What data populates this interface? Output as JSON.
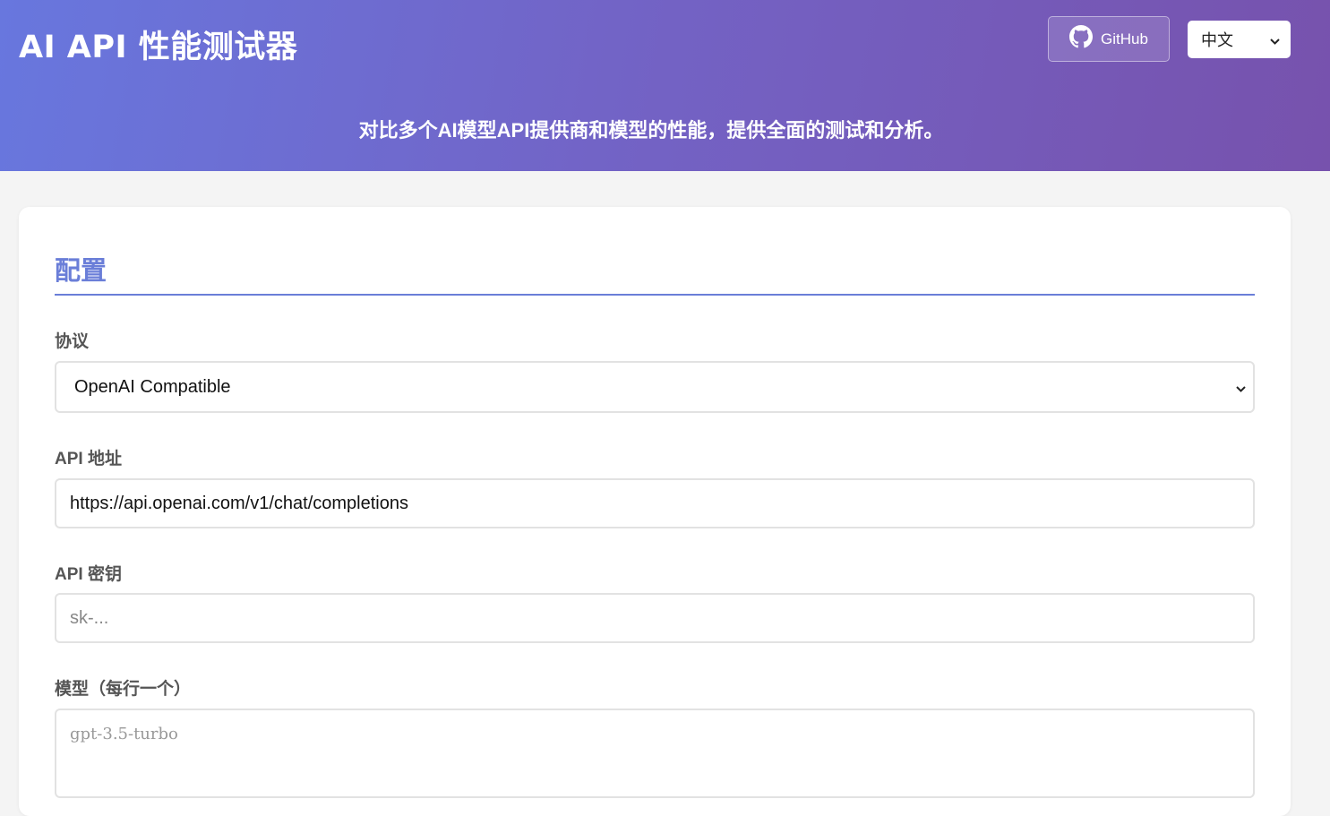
{
  "header": {
    "title": "AI API 性能测试器",
    "subtitle": "对比多个AI模型API提供商和模型的性能，提供全面的测试和分析。",
    "github_label": "GitHub",
    "language_selected": "中文"
  },
  "config": {
    "section_title": "配置",
    "protocol": {
      "label": "协议",
      "value": "OpenAI Compatible"
    },
    "api_url": {
      "label": "API 地址",
      "value": "https://api.openai.com/v1/chat/completions"
    },
    "api_key": {
      "label": "API 密钥",
      "placeholder": "sk-..."
    },
    "models": {
      "label": "模型（每行一个）",
      "placeholder": "gpt-3.5-turbo"
    }
  },
  "icons": {
    "github": "github-icon",
    "dropdown": "chevron-down-icon"
  },
  "colors": {
    "accent": "#6a7ed8",
    "header_gradient_start": "#6877de",
    "header_gradient_end": "#7752ad"
  }
}
